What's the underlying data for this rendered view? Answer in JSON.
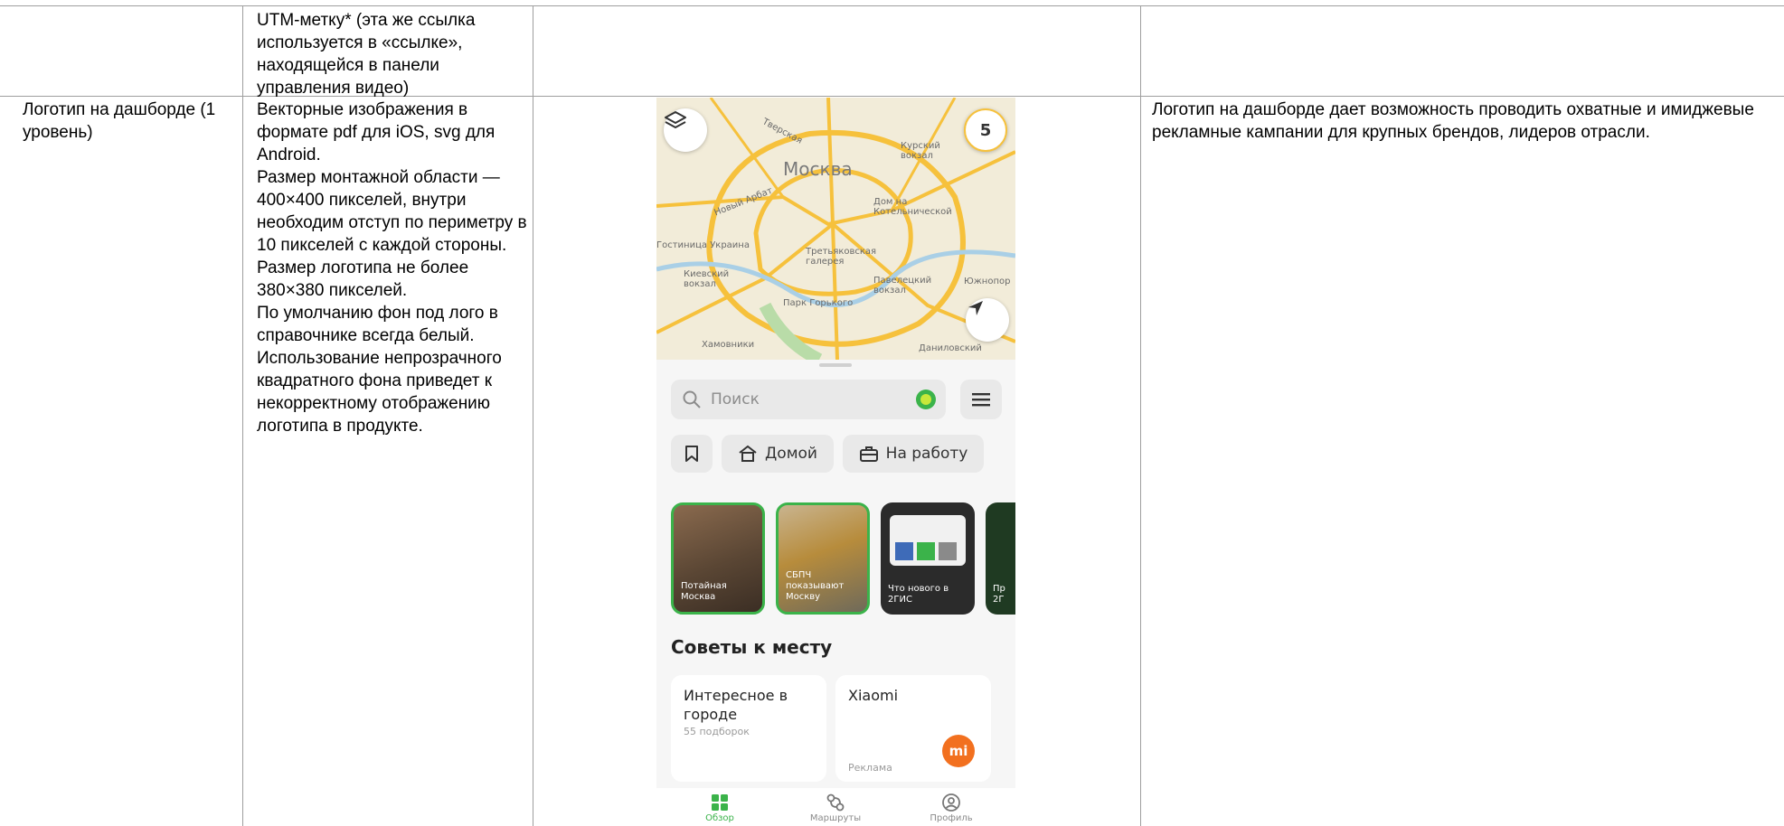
{
  "table": {
    "top_row": {
      "requirements_text": "UTM-метку* (эта же ссылка используется в «ссылке», находящейся в панели управления видео)"
    },
    "logo_row": {
      "placement_name": "Логотип на дашборде (1 уровень)",
      "requirements": [
        "Векторные изображения в формате pdf для iOS, svg для Android.",
        "Размер монтажной области — 400×400 пикселей, внутри необходим отступ по периметру в 10 пикселей с каждой стороны.",
        "Размер логотипа не более 380×380 пикселей.",
        "По умолчанию фон под лого в справочнике всегда белый.",
        "Использование непрозрачного квадратного фона приведет к некорректному отображению логотипа в продукте."
      ],
      "description": "Логотип на дашборде дает возможность проводить охватные и имиджевые рекламные кампании для крупных брендов, лидеров отрасли."
    }
  },
  "phone": {
    "map": {
      "city_label": "Москва",
      "badge_count": "5",
      "labels": {
        "kursky": "Курский вокзал",
        "tverskaya": "Тверская",
        "novy_arbat": "Новый Арбат",
        "kotelnicheskaya": "Дом на Котельнической",
        "ukraina": "Гостиница Украина",
        "kievsky": "Киевский вокзал",
        "tretyakov": "Третьяковская галерея",
        "paveletsky": "Павелецкий вокзал",
        "yuzhnoport": "Южнопор",
        "gorky_park": "Парк Горького",
        "khamovniki": "Хамовники",
        "danilovsky": "Даниловский"
      }
    },
    "search_placeholder": "Поиск",
    "chips": {
      "home": "Домой",
      "work": "На работу"
    },
    "stories": [
      {
        "title": "Потайная Москва"
      },
      {
        "title": "СБПЧ показывают Москву"
      },
      {
        "title": "Что нового в 2ГИС"
      },
      {
        "title": "Пр 2Г"
      }
    ],
    "section_title": "Советы к месту",
    "cards": [
      {
        "title": "Интересное в городе",
        "subtitle": "55 подборок"
      },
      {
        "title": "Xiaomi",
        "subtitle": "Реклама",
        "logo_text": "mi"
      }
    ],
    "tabs": [
      {
        "label": "Обзор"
      },
      {
        "label": "Маршруты"
      },
      {
        "label": "Профиль"
      }
    ],
    "colors": {
      "accent_green": "#3bb34a",
      "xiaomi_orange": "#f2701f",
      "map_bg": "#f2ecd9",
      "road_yellow": "#f6c13c"
    }
  }
}
